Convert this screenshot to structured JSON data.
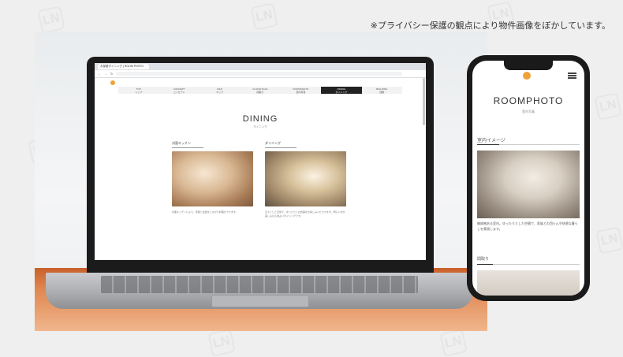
{
  "notice": "※プライバシー保護の観点により物件画像をぼかしています。",
  "watermark_text": "LN",
  "browser": {
    "tab_label": "お部屋ダイニング | ROOM PHOTO"
  },
  "site": {
    "nav": [
      {
        "en": "TOP",
        "jp": "トップ"
      },
      {
        "en": "CONCEPT",
        "jp": "コンセプト"
      },
      {
        "en": "MAP",
        "jp": "マップ"
      },
      {
        "en": "FLOOR PLAN",
        "jp": "間取り"
      },
      {
        "en": "ROOMPHOTO",
        "jp": "室内写真"
      },
      {
        "en": "DINING",
        "jp": "ダイニング"
      },
      {
        "en": "BUILDING",
        "jp": "建物"
      }
    ],
    "page_title": "DINING",
    "page_sub": "ダイニング",
    "col1": {
      "heading": "対面キッチン",
      "text": "対面キッチンにより、家族と会話をしながら料理ができます。"
    },
    "col2": {
      "heading": "ダイニング",
      "text": "広々とした空間で、ゆったりとお食事をお楽しみいただけます。明るい光が差し込む心地よいダイニングです。"
    }
  },
  "phone": {
    "title": "ROOMPHOTO",
    "sub": "室内写真",
    "section": "室内イメージ",
    "text": "開放感ある室内。ゆったりとした空間で、家族との団らんや快適な暮らしを実現します。",
    "section2": "間取り"
  }
}
